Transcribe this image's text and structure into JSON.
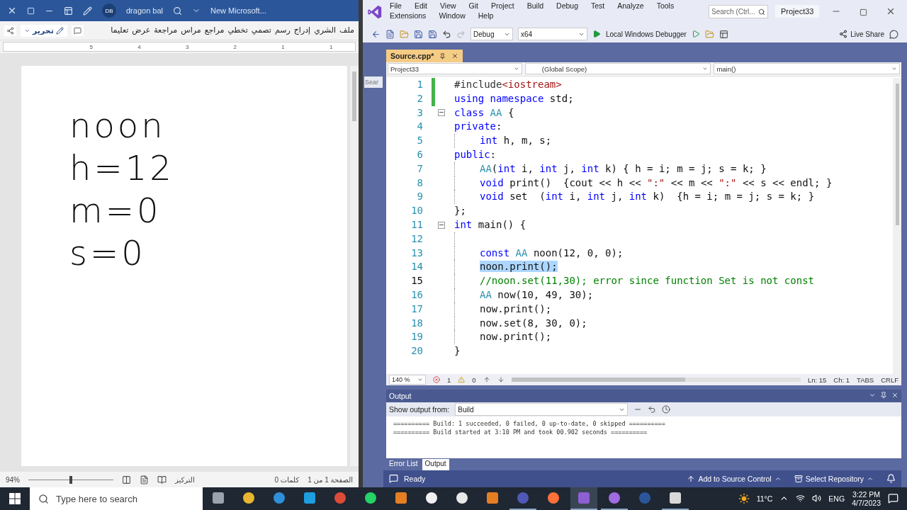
{
  "word": {
    "title_bar": {
      "account_initials": "DB",
      "account_name": "dragon bal",
      "document_title": "New Microsoft..."
    },
    "ribbon_tabs": [
      {
        "label": "ملف",
        "selected": false
      },
      {
        "label": "الشري",
        "selected": false
      },
      {
        "label": "إدراج",
        "selected": false
      },
      {
        "label": "رسم",
        "selected": false
      },
      {
        "label": "تصمي",
        "selected": false
      },
      {
        "label": "تخطي",
        "selected": false
      },
      {
        "label": "مراجع",
        "selected": false
      },
      {
        "label": "مراس",
        "selected": false
      },
      {
        "label": "مراجعة",
        "selected": false
      },
      {
        "label": "عرض",
        "selected": false
      },
      {
        "label": "تعليما",
        "selected": false
      }
    ],
    "edit_mode": "تحرير",
    "ruler_marks": [
      "5",
      "4",
      "3",
      "2",
      "1",
      "1"
    ],
    "ink": [
      "noon",
      "h=12",
      "m=0",
      "s=0"
    ],
    "status_bar": {
      "page": "الصفحة 1 من 1",
      "words": "0 كلمات",
      "focus": "التركيز",
      "zoom": "94%",
      "zoom_slider": {
        "level": 0.5
      }
    }
  },
  "vs": {
    "menu": [
      "File",
      "Edit",
      "View",
      "Git",
      "Project",
      "Build",
      "Debug",
      "Test",
      "Analyze",
      "Tools",
      "Extensions",
      "Window",
      "Help"
    ],
    "search": {
      "placeholder": "Search (Ctrl..."
    },
    "solution_name": "Project33",
    "toolbar": {
      "configuration": "Debug",
      "platform": "x64",
      "debugger": "Local Windows Debugger",
      "live_share": "Live Share"
    },
    "side_panel_label": "Sear",
    "document_tabs": [
      {
        "label": "Source.cpp*",
        "selected": true
      }
    ],
    "navigation": {
      "project": "Project33",
      "scope": "(Global Scope)",
      "member": "main()"
    },
    "code_lines": [
      {
        "number": "1",
        "current": false,
        "changed": true,
        "fold": false,
        "indented": false,
        "segments": [
          {
            "kind": "directive",
            "text": "#include"
          },
          {
            "kind": "string",
            "text": "<iostream>"
          }
        ]
      },
      {
        "number": "2",
        "current": false,
        "changed": true,
        "fold": false,
        "indented": false,
        "segments": [
          {
            "kind": "keyword",
            "text": "using namespace"
          },
          {
            "kind": "plain",
            "text": " std;"
          }
        ]
      },
      {
        "number": "3",
        "current": false,
        "changed": false,
        "fold": true,
        "indented": false,
        "segments": [
          {
            "kind": "keyword",
            "text": "class"
          },
          {
            "kind": "type",
            "text": " AA"
          },
          {
            "kind": "plain",
            "text": " {"
          }
        ]
      },
      {
        "number": "4",
        "current": false,
        "changed": false,
        "fold": false,
        "indented": false,
        "segments": [
          {
            "kind": "keyword",
            "text": "private"
          },
          {
            "kind": "plain",
            "text": ":"
          }
        ]
      },
      {
        "number": "5",
        "current": false,
        "changed": false,
        "fold": false,
        "indented": true,
        "segments": [
          {
            "kind": "keyword",
            "text": "int"
          },
          {
            "kind": "plain",
            "text": " h, m, s;"
          }
        ]
      },
      {
        "number": "6",
        "current": false,
        "changed": false,
        "fold": false,
        "indented": false,
        "segments": [
          {
            "kind": "keyword",
            "text": "public"
          },
          {
            "kind": "plain",
            "text": ":"
          }
        ]
      },
      {
        "number": "7",
        "current": false,
        "changed": false,
        "fold": false,
        "indented": true,
        "segments": [
          {
            "kind": "type",
            "text": "AA"
          },
          {
            "kind": "plain",
            "text": "("
          },
          {
            "kind": "keyword",
            "text": "int"
          },
          {
            "kind": "plain",
            "text": " i, "
          },
          {
            "kind": "keyword",
            "text": "int"
          },
          {
            "kind": "plain",
            "text": " j, "
          },
          {
            "kind": "keyword",
            "text": "int"
          },
          {
            "kind": "plain",
            "text": " k) { h = i; m = j; s = k; }"
          }
        ]
      },
      {
        "number": "8",
        "current": false,
        "changed": false,
        "fold": false,
        "indented": true,
        "segments": [
          {
            "kind": "keyword",
            "text": "void"
          },
          {
            "kind": "plain",
            "text": " print()  {cout << h << "
          },
          {
            "kind": "string",
            "text": "\":\""
          },
          {
            "kind": "plain",
            "text": " << m << "
          },
          {
            "kind": "string",
            "text": "\":\""
          },
          {
            "kind": "plain",
            "text": " << s << endl; }"
          }
        ]
      },
      {
        "number": "9",
        "current": false,
        "changed": false,
        "fold": false,
        "indented": true,
        "segments": [
          {
            "kind": "keyword",
            "text": "void"
          },
          {
            "kind": "plain",
            "text": " set  ("
          },
          {
            "kind": "keyword",
            "text": "int"
          },
          {
            "kind": "plain",
            "text": " i, "
          },
          {
            "kind": "keyword",
            "text": "int"
          },
          {
            "kind": "plain",
            "text": " j, "
          },
          {
            "kind": "keyword",
            "text": "int"
          },
          {
            "kind": "plain",
            "text": " k)  {h = i; m = j; s = k; }"
          }
        ]
      },
      {
        "number": "10",
        "current": false,
        "changed": false,
        "fold": false,
        "indented": false,
        "segments": [
          {
            "kind": "plain",
            "text": "};"
          }
        ]
      },
      {
        "number": "11",
        "current": false,
        "changed": false,
        "fold": true,
        "indented": false,
        "segments": [
          {
            "kind": "keyword",
            "text": "int"
          },
          {
            "kind": "plain",
            "text": " main() {"
          }
        ]
      },
      {
        "number": "12",
        "current": false,
        "changed": false,
        "fold": false,
        "indented": true
      },
      {
        "number": "13",
        "current": false,
        "changed": false,
        "fold": false,
        "indented": true,
        "segments": [
          {
            "kind": "keyword",
            "text": "const"
          },
          {
            "kind": "type",
            "text": " AA"
          },
          {
            "kind": "plain",
            "text": " noon(12, 0, 0);"
          }
        ]
      },
      {
        "number": "14",
        "current": false,
        "changed": false,
        "fold": false,
        "indented": true,
        "segments": [
          {
            "kind": "selection",
            "text": "noon.print();"
          }
        ]
      },
      {
        "number": "15",
        "current": true,
        "changed": false,
        "fold": false,
        "indented": true,
        "segments": [
          {
            "kind": "comment",
            "text": "//noon.set(11,30); error since function Set is not const"
          }
        ]
      },
      {
        "number": "16",
        "current": false,
        "changed": false,
        "fold": false,
        "indented": true,
        "segments": [
          {
            "kind": "type",
            "text": "AA"
          },
          {
            "kind": "plain",
            "text": " now(10, 49, 30);"
          }
        ]
      },
      {
        "number": "17",
        "current": false,
        "changed": false,
        "fold": false,
        "indented": true,
        "segments": [
          {
            "kind": "plain",
            "text": "now.print();"
          }
        ]
      },
      {
        "number": "18",
        "current": false,
        "changed": false,
        "fold": false,
        "indented": true,
        "segments": [
          {
            "kind": "plain",
            "text": "now.set(8, 30, 0);"
          }
        ]
      },
      {
        "number": "19",
        "current": false,
        "changed": false,
        "fold": false,
        "indented": true,
        "segments": [
          {
            "kind": "plain",
            "text": "now.print();"
          }
        ]
      },
      {
        "number": "20",
        "current": false,
        "changed": false,
        "fold": false,
        "indented": false,
        "segments": [
          {
            "kind": "plain",
            "text": "}"
          }
        ]
      }
    ],
    "editor_status": {
      "zoom": "140 %",
      "errors": "1",
      "warnings": "0",
      "line": "Ln: 15",
      "column": "Ch: 1",
      "indent": "TABS",
      "line_endings": "CRLF"
    },
    "output": {
      "title": "Output",
      "source_label": "Show output from:",
      "source": "Build",
      "lines": [
        "========== Build: 1 succeeded, 0 failed, 0 up-to-date, 0 skipped ==========",
        "========== Build started at 3:10 PM and took 00.902 seconds =========="
      ]
    },
    "tool_tabs": [
      {
        "label": "Error List",
        "selected": false
      },
      {
        "label": "Output",
        "selected": true
      }
    ],
    "status_bar": {
      "state": "Ready",
      "source_control": "Add to Source Control",
      "repository": "Select Repository"
    }
  },
  "taskbar": {
    "search": {
      "placeholder": "Type here to search"
    },
    "apps": [
      {
        "open": false,
        "selected": false
      },
      {
        "open": false,
        "selected": false
      },
      {
        "open": false,
        "selected": false
      },
      {
        "open": false,
        "selected": false
      },
      {
        "open": false,
        "selected": false
      },
      {
        "open": false,
        "selected": false
      },
      {
        "open": false,
        "selected": false
      },
      {
        "open": false,
        "selected": false
      },
      {
        "open": false,
        "selected": false
      },
      {
        "open": false,
        "selected": false
      },
      {
        "open": true,
        "selected": false
      },
      {
        "open": false,
        "selected": false
      },
      {
        "open": true,
        "selected": true
      },
      {
        "open": true,
        "selected": false
      },
      {
        "open": false,
        "selected": false
      },
      {
        "open": true,
        "selected": false
      }
    ],
    "weather": "11°C",
    "language": "ENG",
    "time": "3:22 PM",
    "date": "4/7/2023"
  }
}
